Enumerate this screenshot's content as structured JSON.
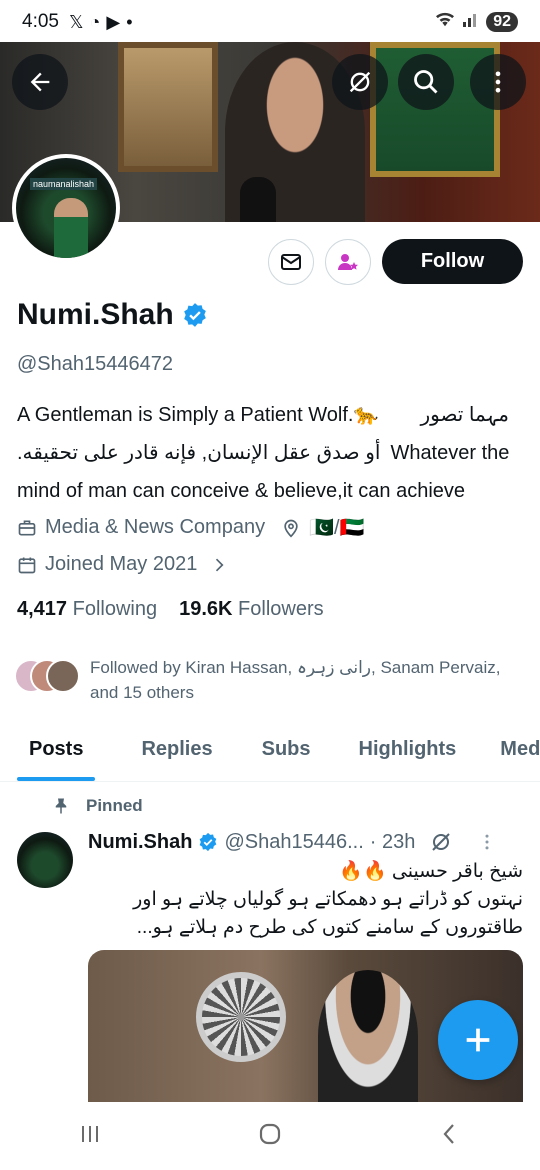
{
  "status_bar": {
    "time": "4:05",
    "icons": [
      "x-icon",
      "whatsapp-icon",
      "youtube-icon",
      "dot-icon"
    ],
    "battery": "92"
  },
  "profile": {
    "name": "Numi.Shah",
    "handle": "@Shah15446472",
    "verified": true,
    "avatar_tag": "naumanalishah",
    "bio_line1_en": "A Gentleman is Simply a Patient Wolf.🐆",
    "bio_line1_ur": "مہما تصور",
    "bio_line2_ur": "أو صدق عقل الإنسان, فإنه قادر على تحقيقه.",
    "bio_line2_en": "Whatever the",
    "bio_line3": "mind of man can conceive & believe,it can achieve",
    "category": "Media & News Company",
    "location": "🇵🇰/🇦🇪",
    "joined": "Joined May 2021",
    "following_count": "4,417",
    "following_label": "Following",
    "followers_count": "19.6K",
    "followers_label": "Followers",
    "followed_by": "Followed by Kiran Hassan, رانی زہرہ, Sanam Pervaiz, and 15 others"
  },
  "actions": {
    "follow_label": "Follow"
  },
  "tabs": [
    {
      "label": "Posts",
      "active": true
    },
    {
      "label": "Replies",
      "active": false
    },
    {
      "label": "Subs",
      "active": false
    },
    {
      "label": "Highlights",
      "active": false
    },
    {
      "label": "Media",
      "active": false
    }
  ],
  "post": {
    "pinned_label": "Pinned",
    "author": "Numi.Shah",
    "handle": "@Shah15446...",
    "time": "· 23h",
    "line1": "شیخ باقر حسینی 🔥🔥",
    "line2": "نہتوں کو ڈراتے ہو دھمکاتے ہو گولیاں چلاتے ہو اور",
    "line3": "طاقتوروں کے سامنے کتوں کی طرح دم ہلاتے ہو..."
  },
  "colors": {
    "accent": "#1d9bf0",
    "text": "#0f1419",
    "muted": "#536471",
    "subscribe_pink": "#c936c4"
  }
}
